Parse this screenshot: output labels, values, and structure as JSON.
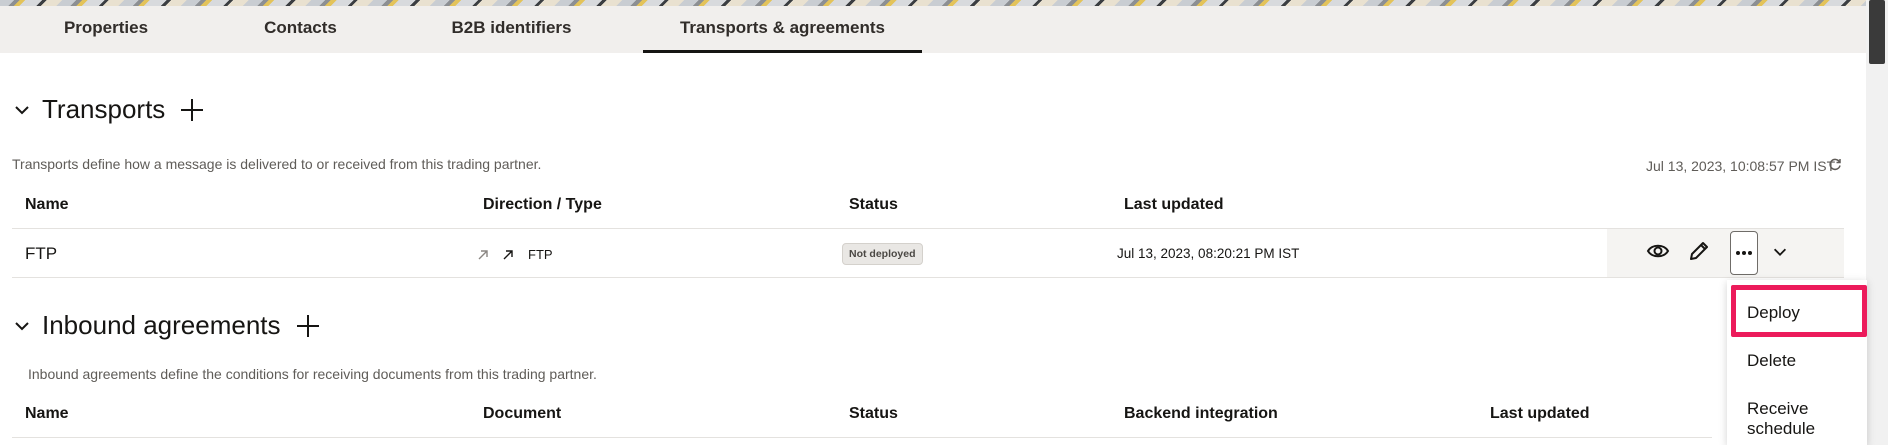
{
  "tabs": [
    {
      "label": "Properties"
    },
    {
      "label": "Contacts"
    },
    {
      "label": "B2B identifiers"
    },
    {
      "label": "Transports & agreements"
    }
  ],
  "transports": {
    "title": "Transports",
    "description": "Transports define how a message is delivered to or received from this trading partner.",
    "refreshed": "Jul 13, 2023, 10:08:57 PM IST",
    "columns": [
      "Name",
      "Direction / Type",
      "Status",
      "Last updated"
    ],
    "rows": [
      {
        "name": "FTP",
        "type": "FTP",
        "status": "Not deployed",
        "updated": "Jul 13, 2023, 08:20:21 PM IST"
      }
    ]
  },
  "inbound": {
    "title": "Inbound agreements",
    "description": "Inbound agreements define the conditions for receiving documents from this trading partner.",
    "columns": [
      "Name",
      "Document",
      "Status",
      "Backend integration",
      "Last updated"
    ]
  },
  "row_menu": {
    "items": [
      "Deploy",
      "Delete",
      "Receive schedule"
    ],
    "highlight_color": "#ec1b5b"
  }
}
